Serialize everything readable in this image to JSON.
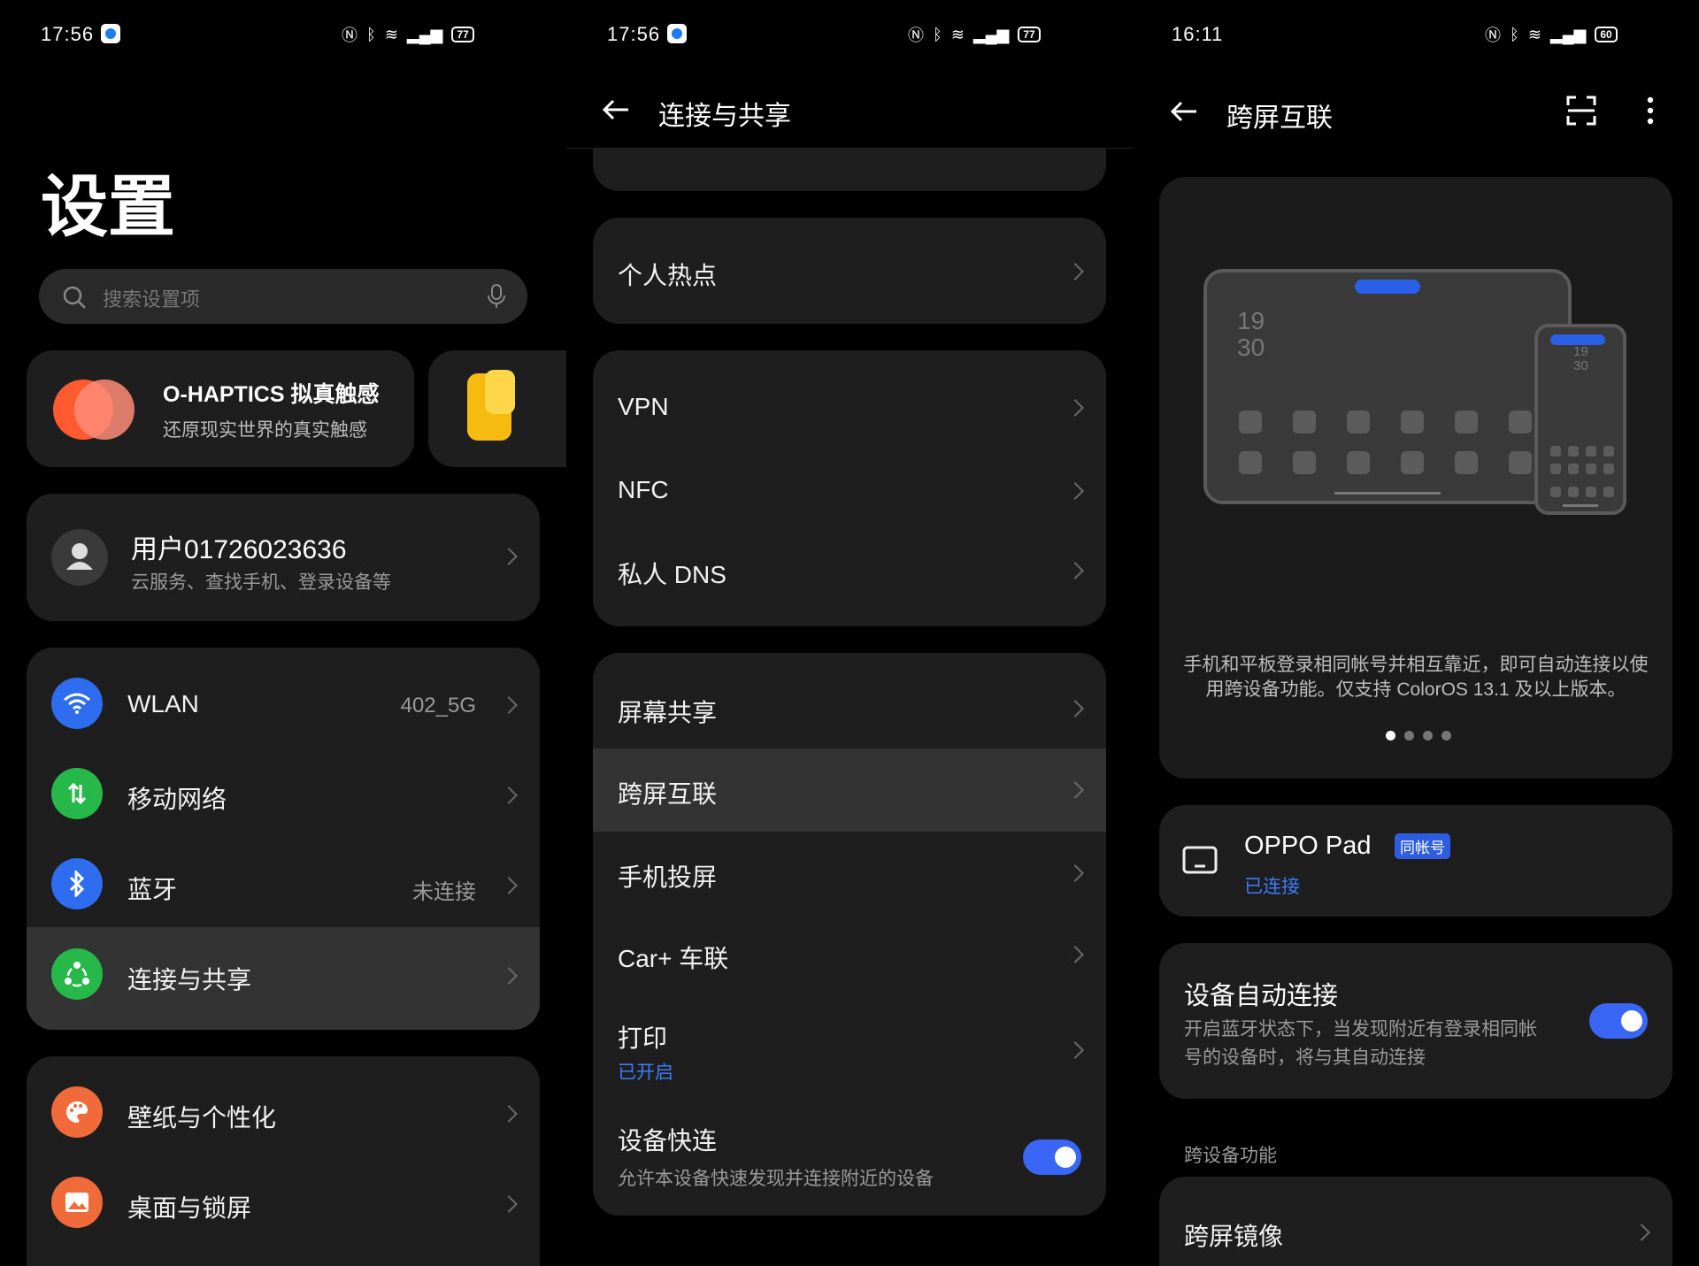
{
  "panel1": {
    "status": {
      "time": "17:56",
      "battery": "77"
    },
    "title": "设置",
    "search": {
      "placeholder": "搜索设置项"
    },
    "promo": {
      "title": "O-HAPTICS 拟真触感",
      "subtitle": "还原现实世界的真实触感"
    },
    "account": {
      "name": "用户01726023636",
      "subtitle": "云服务、查找手机、登录设备等"
    },
    "network_items": [
      {
        "label": "WLAN",
        "value": "402_5G",
        "icon": "wifi-icon",
        "color": "#2e6cf0"
      },
      {
        "label": "移动网络",
        "value": "",
        "icon": "mobile-data-icon",
        "color": "#27b84a"
      },
      {
        "label": "蓝牙",
        "value": "未连接",
        "icon": "bluetooth-icon",
        "color": "#2e6cf0"
      },
      {
        "label": "连接与共享",
        "value": "",
        "icon": "share-icon",
        "color": "#27b84a"
      }
    ],
    "personal_items": [
      {
        "label": "壁纸与个性化",
        "icon": "palette-icon",
        "color": "#f06a3a"
      },
      {
        "label": "桌面与锁屏",
        "icon": "picture-icon",
        "color": "#f06a3a"
      }
    ]
  },
  "panel2": {
    "status": {
      "time": "17:56",
      "battery": "77"
    },
    "header": "连接与共享",
    "hotspot": "个人热点",
    "group2": [
      "VPN",
      "NFC",
      "私人 DNS"
    ],
    "group3": [
      {
        "label": "屏幕共享"
      },
      {
        "label": "跨屏互联"
      },
      {
        "label": "手机投屏"
      },
      {
        "label": "Car+ 车联"
      },
      {
        "label": "打印",
        "sub": "已开启"
      }
    ],
    "quick": {
      "label": "设备快连",
      "sub": "允许本设备快速发现并连接附近的设备",
      "enabled": true
    }
  },
  "panel3": {
    "status": {
      "time": "16:11",
      "battery": "60"
    },
    "header": "跨屏互联",
    "illustration": {
      "tablet_time": [
        "19",
        "30"
      ],
      "phone_time": [
        "19",
        "30"
      ]
    },
    "desc": [
      "手机和平板登录相同帐号并相互靠近，即可自动连接以使",
      "用跨设备功能。仅支持 ColorOS 13.1 及以上版本。"
    ],
    "pager": {
      "count": 4,
      "active": 1
    },
    "device": {
      "name": "OPPO Pad",
      "badge": "同帐号",
      "status": "已连接"
    },
    "auto": {
      "label": "设备自动连接",
      "desc": [
        "开启蓝牙状态下，当发现附近有登录相同帐",
        "号的设备时，将与其自动连接"
      ],
      "enabled": true
    },
    "section": "跨设备功能",
    "mirror": "跨屏镜像"
  }
}
